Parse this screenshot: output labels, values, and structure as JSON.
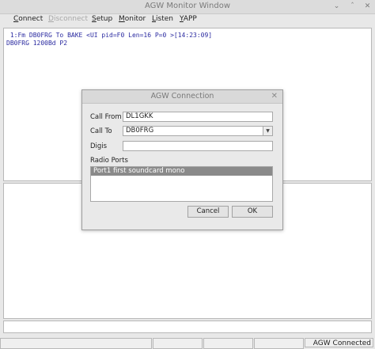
{
  "window": {
    "title": "AGW Monitor Window"
  },
  "menu": {
    "items": [
      {
        "label_first": "C",
        "label_rest": "onnect"
      },
      {
        "label_first": "D",
        "label_rest": "isconnect"
      },
      {
        "label_first": "S",
        "label_rest": "etup"
      },
      {
        "label_first": "M",
        "label_rest": "onitor"
      },
      {
        "label_first": "L",
        "label_rest": "isten"
      },
      {
        "label_first": "Y",
        "label_rest": "APP"
      }
    ]
  },
  "monitor": {
    "lines": [
      " 1:Fm DB0FRG To BAKE <UI pid=F0 Len=16 P=0 >[14:23:09]",
      "DB0FRG 1200Bd P2"
    ]
  },
  "status": {
    "connection": "AGW Connected"
  },
  "dialog": {
    "title": "AGW Connection",
    "call_from_label": "Call From",
    "call_from_value": "DL1GKK",
    "call_to_label": "Call To",
    "call_to_value": "DB0FRG",
    "digis_label": "Digis",
    "digis_value": "",
    "radio_ports_label": "Radio Ports",
    "radio_ports": [
      "Port1 first soundcard mono"
    ],
    "cancel_label": "Cancel",
    "ok_label": "OK"
  },
  "colors": {
    "monitor_text": "#2a2aa0",
    "selection": "#8a8a8a"
  }
}
